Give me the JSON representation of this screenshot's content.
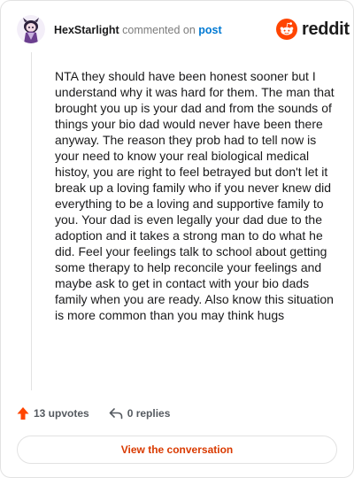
{
  "header": {
    "username": "HexStarlight",
    "action_text": " commented on ",
    "post_link": "post"
  },
  "logo": {
    "wordmark": "reddit",
    "color": "#ff4500",
    "icon": "reddit-alien-icon"
  },
  "comment": {
    "body": "NTA they should have been honest sooner but I understand why it was hard for them. The man that brought you up is your dad and from the sounds of things your bio dad would never have been there anyway. The reason they prob had to tell now is your need to know your real biological medical histoy, you are right to feel betrayed but don't let it break up a loving family who if you never knew did everything to be a loving and supportive family to you. Your dad is even legally your dad due to the adoption and it takes a strong man to do what he did. Feel your feelings talk to school about getting some therapy to help reconcile your feelings and maybe ask to get in contact with your bio dads family when you are ready. Also know this situation is more common than you may think hugs"
  },
  "actions": {
    "upvotes": "13 upvotes",
    "upvote_icon": "upvote-arrow-icon",
    "replies": "0 replies",
    "reply_icon": "reply-arrow-icon",
    "upvote_color": "#ff4500"
  },
  "footer": {
    "button_label": "View the conversation",
    "button_color": "#d93a00"
  }
}
